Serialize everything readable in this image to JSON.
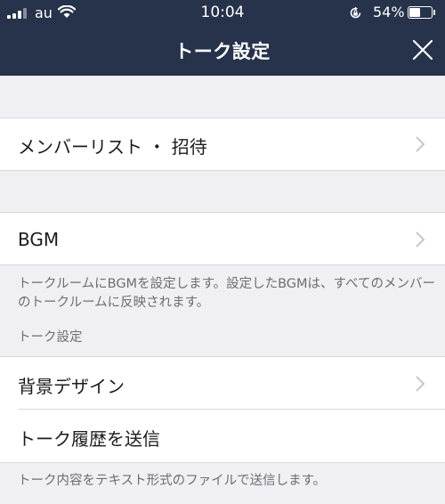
{
  "status_bar": {
    "carrier": "au",
    "time": "10:04",
    "battery_percent": "54%",
    "battery_level": 0.54
  },
  "header": {
    "title": "トーク設定",
    "close_icon": "close-icon"
  },
  "rows": {
    "member_list": {
      "label": "メンバーリスト ・ 招待"
    },
    "bgm": {
      "label": "BGM"
    },
    "background": {
      "label": "背景デザイン"
    },
    "send_history": {
      "label": "トーク履歴を送信"
    }
  },
  "notes": {
    "bgm_description": "トークルームにBGMを設定します。設定したBGMは、すべてのメンバーのトークルームに反映されます。",
    "section_talk_settings": "トーク設定",
    "send_description": "トーク内容をテキスト形式のファイルで送信します。"
  },
  "colors": {
    "header_bg": "#27324b",
    "page_bg": "#efeff4",
    "chevron": "#c7c7cc"
  }
}
